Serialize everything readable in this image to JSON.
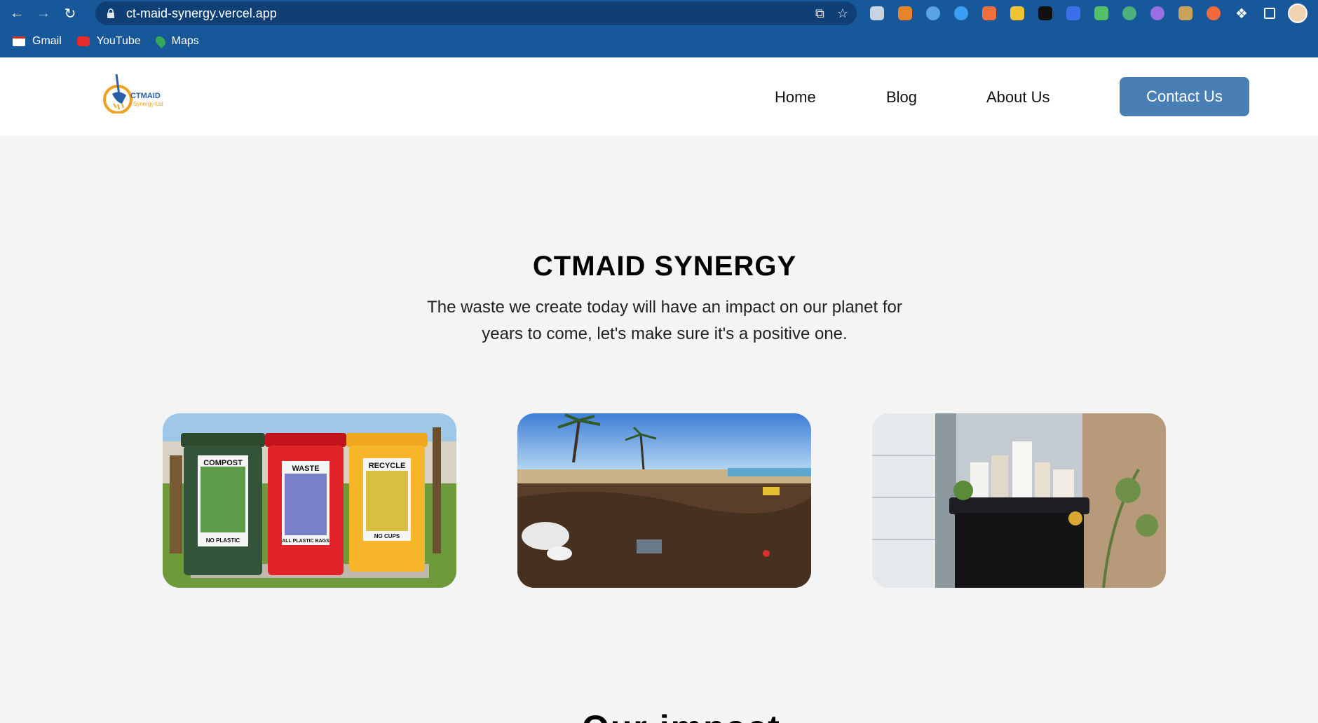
{
  "browser": {
    "url": "ct-maid-synergy.vercel.app",
    "bookmarks": [
      {
        "label": "Gmail",
        "icon": "gmail-icon"
      },
      {
        "label": "YouTube",
        "icon": "youtube-icon"
      },
      {
        "label": "Maps",
        "icon": "maps-icon"
      }
    ]
  },
  "site": {
    "logo": {
      "text_main": "CTMAID",
      "text_sub": "Synergy Ltd"
    },
    "nav": {
      "home": "Home",
      "blog": "Blog",
      "about": "About Us",
      "contact": "Contact Us"
    },
    "hero": {
      "title": "CTMAID SYNERGY",
      "subtitle": "The waste we create today will have an impact on our planet for years to come, let's make sure it's a positive one."
    },
    "bins": {
      "compost": "COMPOST",
      "compost_sub": "NO PLASTIC",
      "waste": "WASTE",
      "waste_sub": "ALL PLASTIC BAGS",
      "recycle": "RECYCLE",
      "recycle_sub": "NO CUPS"
    },
    "next_heading": "Our impact"
  },
  "colors": {
    "browser_bar": "#17589b",
    "contact_button": "#4a7fb6",
    "page_bg": "#f4f4f4"
  }
}
